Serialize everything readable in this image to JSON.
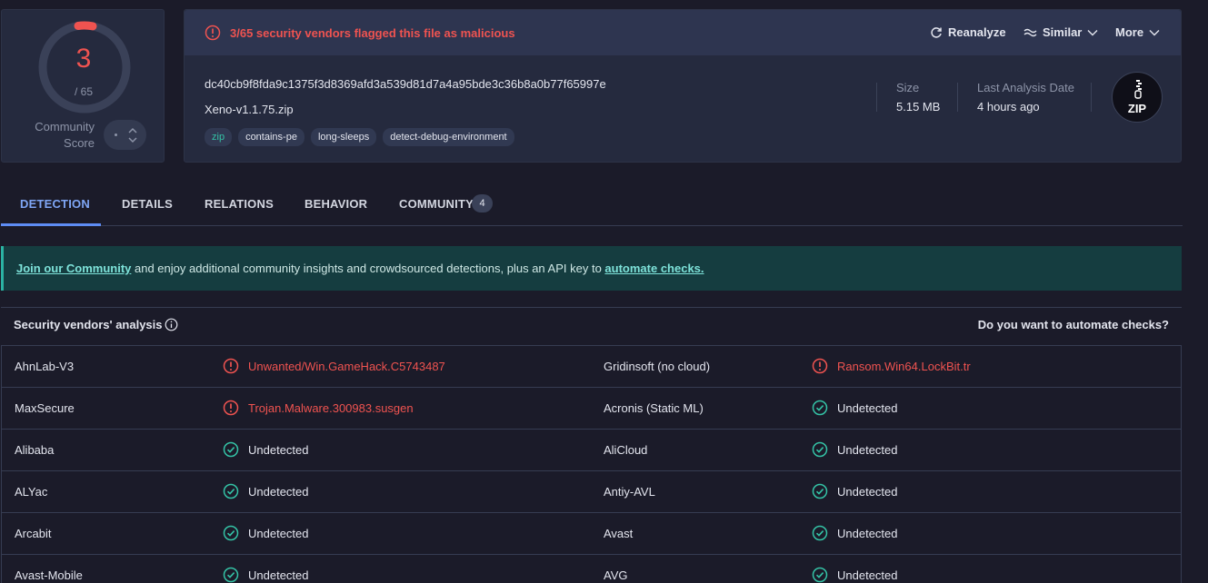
{
  "score": {
    "detected": "3",
    "total": "/ 65",
    "community_label_1": "Community",
    "community_label_2": "Score"
  },
  "alert": {
    "text": "3/65 security vendors flagged this file as malicious"
  },
  "actions": {
    "reanalyze": "Reanalyze",
    "similar": "Similar",
    "more": "More"
  },
  "file": {
    "hash": "dc40cb9f8fda9c1375f3d8369afd3a539d81d7a4a95bde3c36b8a0b77f65997e",
    "name": "Xeno-v1.1.75.zip",
    "tags": [
      "zip",
      "contains-pe",
      "long-sleeps",
      "detect-debug-environment"
    ],
    "size_label": "Size",
    "size_value": "5.15 MB",
    "date_label": "Last Analysis Date",
    "date_value": "4 hours ago",
    "type_badge": "ZIP"
  },
  "tabs": [
    {
      "label": "DETECTION"
    },
    {
      "label": "DETAILS"
    },
    {
      "label": "RELATIONS"
    },
    {
      "label": "BEHAVIOR"
    },
    {
      "label": "COMMUNITY",
      "count": "4"
    }
  ],
  "banner": {
    "link1": "Join our Community",
    "text": " and enjoy additional community insights and crowdsourced detections, plus an API key to ",
    "link2": "automate checks."
  },
  "vendors_header": {
    "title": "Security vendors' analysis",
    "right": "Do you want to automate checks?"
  },
  "vendors": [
    {
      "left": {
        "name": "AhnLab-V3",
        "result": "Unwanted/Win.GameHack.C5743487",
        "status": "malicious"
      },
      "right": {
        "name": "Gridinsoft (no cloud)",
        "result": "Ransom.Win64.LockBit.tr",
        "status": "malicious"
      }
    },
    {
      "left": {
        "name": "MaxSecure",
        "result": "Trojan.Malware.300983.susgen",
        "status": "malicious"
      },
      "right": {
        "name": "Acronis (Static ML)",
        "result": "Undetected",
        "status": "undetected"
      }
    },
    {
      "left": {
        "name": "Alibaba",
        "result": "Undetected",
        "status": "undetected"
      },
      "right": {
        "name": "AliCloud",
        "result": "Undetected",
        "status": "undetected"
      }
    },
    {
      "left": {
        "name": "ALYac",
        "result": "Undetected",
        "status": "undetected"
      },
      "right": {
        "name": "Antiy-AVL",
        "result": "Undetected",
        "status": "undetected"
      }
    },
    {
      "left": {
        "name": "Arcabit",
        "result": "Undetected",
        "status": "undetected"
      },
      "right": {
        "name": "Avast",
        "result": "Undetected",
        "status": "undetected"
      }
    },
    {
      "left": {
        "name": "Avast-Mobile",
        "result": "Undetected",
        "status": "undetected"
      },
      "right": {
        "name": "AVG",
        "result": "Undetected",
        "status": "undetected"
      }
    }
  ],
  "colors": {
    "malicious": "#ef5350",
    "undetected": "#34c3a6",
    "accent": "#5e8df5"
  }
}
